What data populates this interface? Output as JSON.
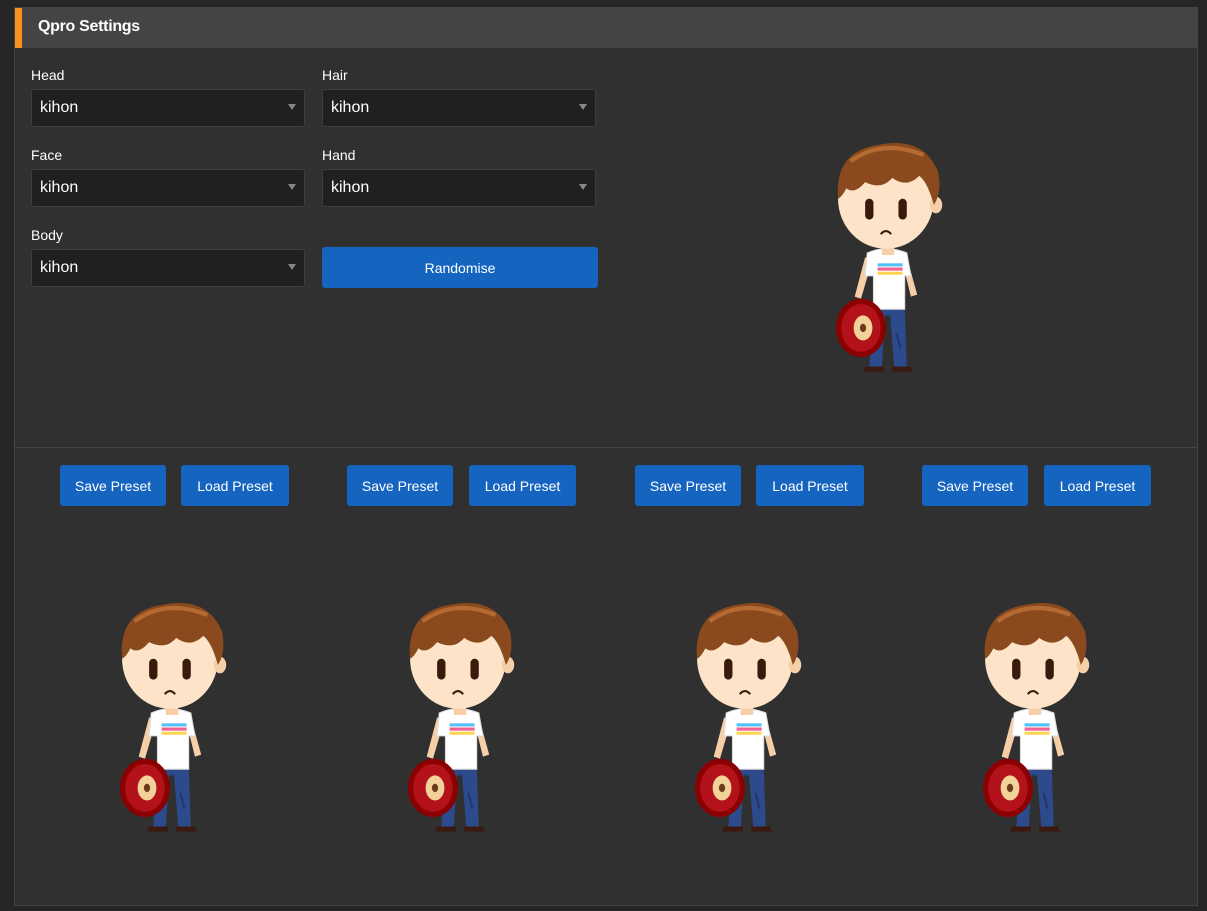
{
  "panel": {
    "title": "Qpro Settings"
  },
  "fields": {
    "head": {
      "label": "Head",
      "value": "kihon"
    },
    "hair": {
      "label": "Hair",
      "value": "kihon"
    },
    "face": {
      "label": "Face",
      "value": "kihon"
    },
    "hand": {
      "label": "Hand",
      "value": "kihon"
    },
    "body": {
      "label": "Body",
      "value": "kihon"
    }
  },
  "randomise_label": "Randomise",
  "presets": [
    {
      "save_label": "Save Preset",
      "load_label": "Load Preset"
    },
    {
      "save_label": "Save Preset",
      "load_label": "Load Preset"
    },
    {
      "save_label": "Save Preset",
      "load_label": "Load Preset"
    },
    {
      "save_label": "Save Preset",
      "load_label": "Load Preset"
    }
  ],
  "colors": {
    "accent": "#f7931e",
    "button": "#1565c0",
    "panel": "#303030",
    "header": "#444444"
  }
}
